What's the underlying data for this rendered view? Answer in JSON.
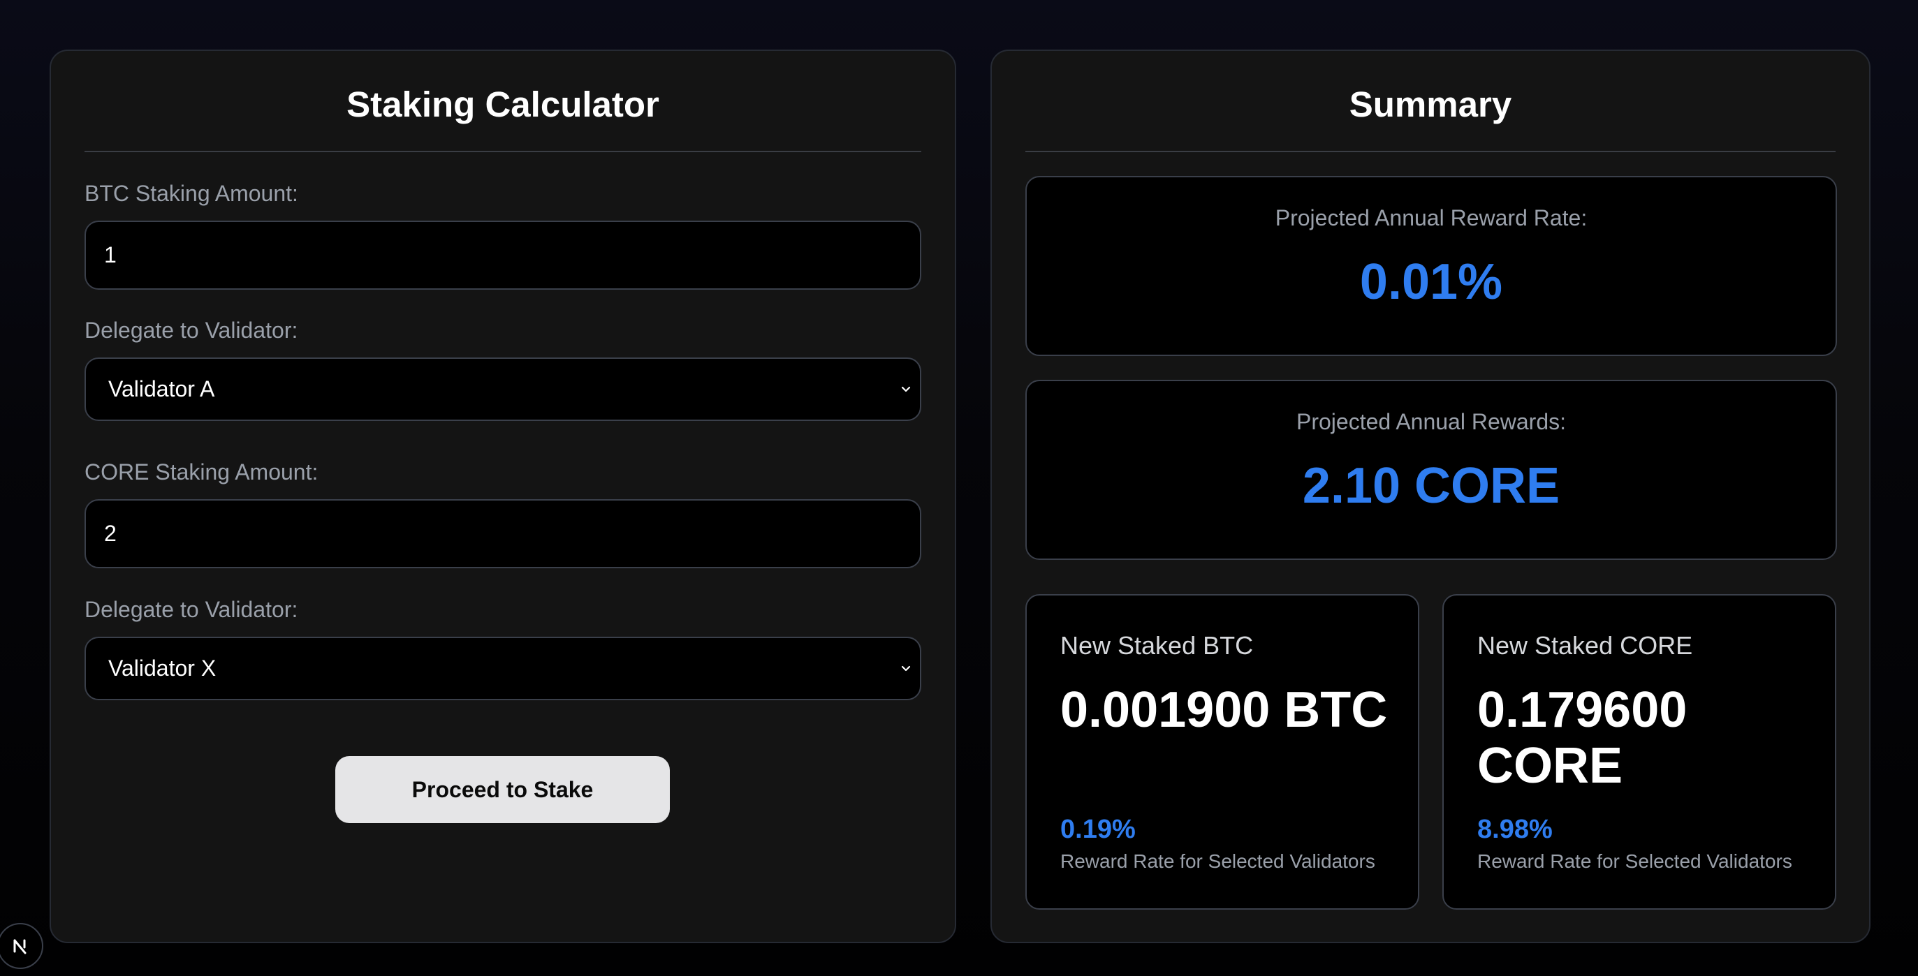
{
  "calculator": {
    "title": "Staking Calculator",
    "btc_amount_label": "BTC Staking Amount:",
    "btc_amount_value": "1",
    "btc_validator_label": "Delegate to Validator:",
    "btc_validator_selected": "Validator A",
    "core_amount_label": "CORE Staking Amount:",
    "core_amount_value": "2",
    "core_validator_label": "Delegate to Validator:",
    "core_validator_selected": "Validator X",
    "proceed_label": "Proceed to Stake"
  },
  "summary": {
    "title": "Summary",
    "reward_rate_label": "Projected Annual Reward Rate:",
    "reward_rate_value": "0.01%",
    "rewards_label": "Projected Annual Rewards:",
    "rewards_value": "2.10 CORE",
    "btc_card": {
      "label": "New Staked BTC",
      "value": "0.001900 BTC",
      "rate": "0.19%",
      "note": "Reward Rate for Selected Validators"
    },
    "core_card": {
      "label": "New Staked CORE",
      "value": "0.179600 CORE",
      "rate": "8.98%",
      "note": "Reward Rate for Selected Validators"
    }
  },
  "badge": {
    "icon": "next-logo-icon"
  },
  "colors": {
    "accent": "#2f7df0",
    "panel_bg": "#141414",
    "button_bg": "#e5e5e7"
  }
}
